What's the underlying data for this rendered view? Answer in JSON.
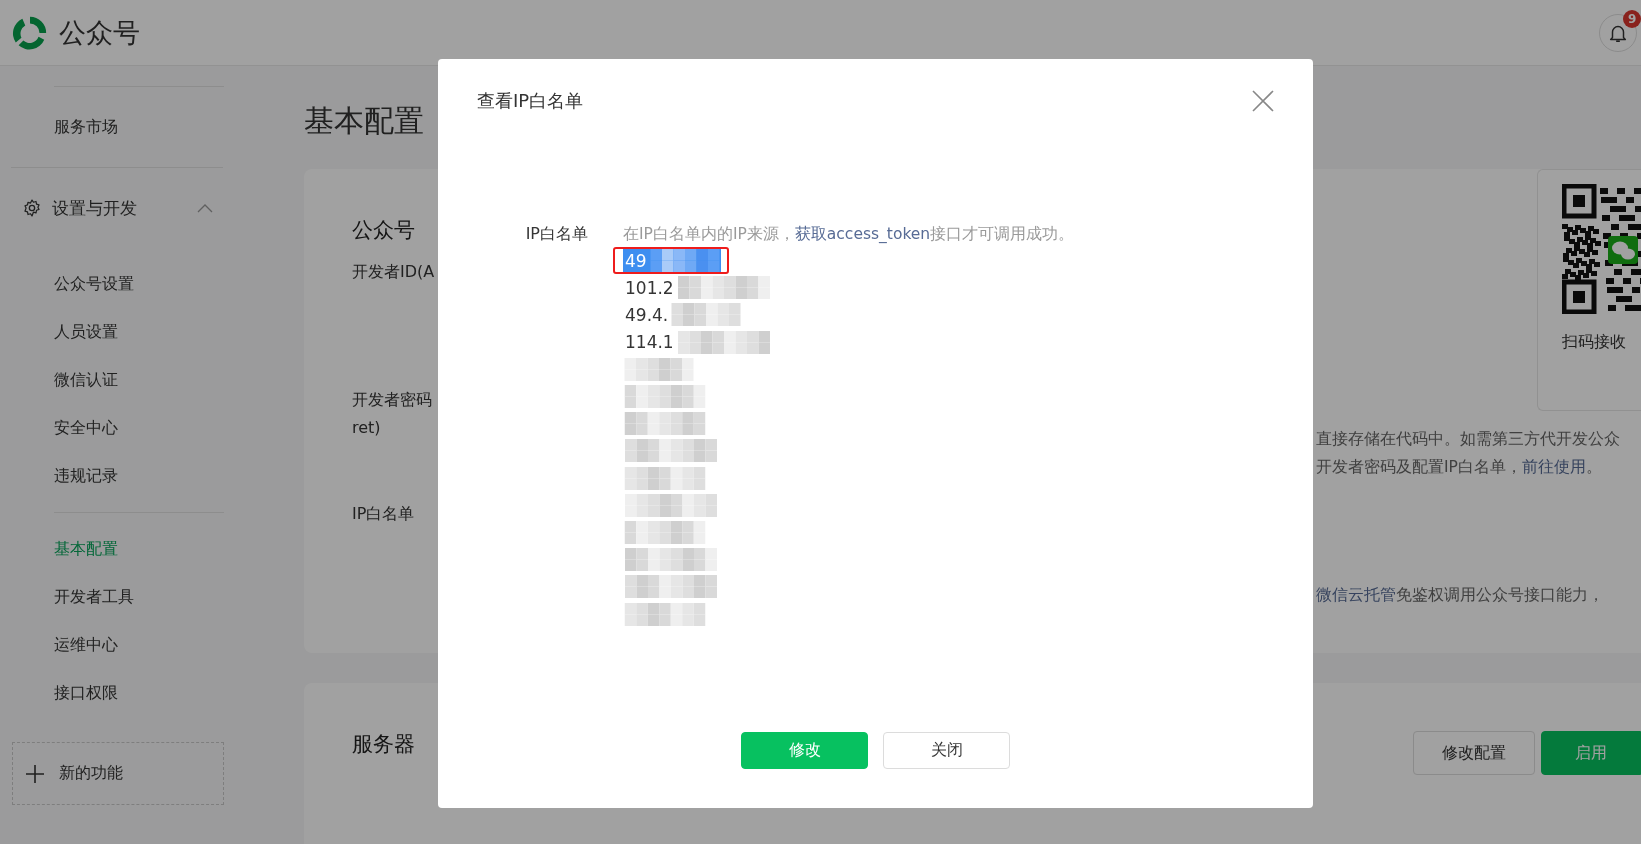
{
  "header": {
    "brand": "公众号",
    "notification_badge": "9"
  },
  "sidebar": {
    "top_items": [
      {
        "label": "服务市场",
        "selected": false
      }
    ],
    "groups": [
      {
        "label": "设置与开发",
        "expanded": true,
        "sections": [
          {
            "items": [
              {
                "label": "公众号设置",
                "selected": false
              },
              {
                "label": "人员设置",
                "selected": false
              },
              {
                "label": "微信认证",
                "selected": false
              },
              {
                "label": "安全中心",
                "selected": false
              },
              {
                "label": "违规记录",
                "selected": false
              }
            ]
          },
          {
            "items": [
              {
                "label": "基本配置",
                "selected": true
              },
              {
                "label": "开发者工具",
                "selected": false
              },
              {
                "label": "运维中心",
                "selected": false
              },
              {
                "label": "接口权限",
                "selected": false
              }
            ]
          }
        ]
      }
    ],
    "new_feature": "新的功能"
  },
  "page_title": "基本配置",
  "developer_card": {
    "section_title": "公众号",
    "fields": [
      {
        "label": "开发者ID(A"
      },
      {
        "label": "开发者密码",
        "label_line_2": "ret)"
      },
      {
        "label": "IP白名单"
      }
    ],
    "qr_caption": "扫码接收",
    "notes": [
      {
        "before": "直接存储在代码中。如需第三方代开发公众"
      },
      {
        "before": "开发者密码及配置IP白名单，",
        "link": "前往使用",
        "after": "。"
      },
      {
        "link": "微信云托管",
        "after": "免鉴权调用公众号接口能力，"
      }
    ]
  },
  "server_card": {
    "section_title": "服务器",
    "buttons": [
      {
        "label": "修改配置",
        "kind": "secondary"
      },
      {
        "label": "启用",
        "kind": "primary"
      }
    ]
  },
  "dialog": {
    "title": "查看IP白名单",
    "field_label": "IP白名单",
    "hint": {
      "before": "在IP白名单内的IP来源，",
      "link": "获取access_token",
      "after": "接口才可调用成功。"
    },
    "ip_list": [
      {
        "kind": "partial",
        "text": "49",
        "selected": true,
        "outlined": true
      },
      {
        "kind": "partial",
        "text": "101.2",
        "selected": false,
        "outlined": false
      },
      {
        "kind": "partial",
        "text": "49.4.",
        "selected": false,
        "outlined": false
      },
      {
        "kind": "partial",
        "text": "114.1",
        "selected": false,
        "outlined": false
      },
      {
        "kind": "masked",
        "selected": false,
        "outlined": false
      },
      {
        "kind": "masked",
        "selected": false,
        "outlined": false
      },
      {
        "kind": "masked",
        "selected": false,
        "outlined": false
      },
      {
        "kind": "masked",
        "selected": false,
        "outlined": false
      },
      {
        "kind": "masked",
        "selected": false,
        "outlined": false
      },
      {
        "kind": "masked",
        "selected": false,
        "outlined": false
      },
      {
        "kind": "masked",
        "selected": false,
        "outlined": false
      },
      {
        "kind": "masked",
        "selected": false,
        "outlined": false
      },
      {
        "kind": "masked",
        "selected": false,
        "outlined": false
      },
      {
        "kind": "masked",
        "selected": false,
        "outlined": false
      }
    ],
    "buttons": [
      {
        "label": "修改",
        "kind": "primary"
      },
      {
        "label": "关闭",
        "kind": "secondary"
      }
    ]
  }
}
